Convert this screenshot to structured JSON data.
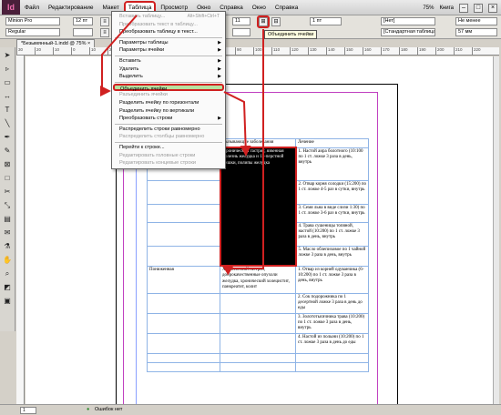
{
  "menubar": {
    "logo": "Id",
    "items": [
      "Файл",
      "Редактирование",
      "Макет",
      "Таблица",
      "Просмотр",
      "Окно",
      "Справка",
      "Окно",
      "Справка"
    ],
    "zoom": "75%",
    "workspace": "Книга"
  },
  "controlbar": {
    "font": "Minion Pro",
    "style": "Regular",
    "size1": "12 пт",
    "size2": "11",
    "stroke": "1 пт",
    "cell_style": "[Нет]",
    "table_style": "[Стандартная таблица]",
    "min_label": "Не менее",
    "height": "57 мм",
    "tooltip": "Объединить ячейки"
  },
  "doc_tab": "*Безымянный-1.indd @ 75% ×",
  "ruler_marks": [
    "30",
    "20",
    "10",
    "0",
    "10",
    "20",
    "30",
    "40",
    "50",
    "60",
    "70",
    "80",
    "90",
    "100",
    "110",
    "120",
    "130",
    "140",
    "150",
    "160",
    "170",
    "180",
    "190",
    "200",
    "210",
    "220"
  ],
  "table_menu": {
    "items": [
      {
        "label": "Вставить таблицу...",
        "shortcut": "Alt+Shift+Ctrl+T",
        "disabled": true
      },
      {
        "label": "Преобразовать текст в таблицу...",
        "disabled": true
      },
      {
        "label": "Преобразовать таблицу в текст...",
        "disabled": false
      },
      {
        "sep": true
      },
      {
        "label": "Параметры таблицы",
        "arrow": true
      },
      {
        "label": "Параметры ячейки",
        "arrow": true
      },
      {
        "sep": true
      },
      {
        "label": "Вставить",
        "arrow": true
      },
      {
        "label": "Удалить",
        "arrow": true
      },
      {
        "label": "Выделить",
        "arrow": true
      },
      {
        "sep": true
      },
      {
        "label": "Объединить ячейки",
        "highlight": true
      },
      {
        "label": "Разъединить ячейки",
        "disabled": true
      },
      {
        "label": "Разделить ячейку по горизонтали"
      },
      {
        "label": "Разделить ячейку по вертикали"
      },
      {
        "label": "Преобразовать строки",
        "arrow": true
      },
      {
        "sep": true
      },
      {
        "label": "Распределить строки равномерно"
      },
      {
        "label": "Распределить столбцы равномерно",
        "disabled": true
      },
      {
        "sep": true
      },
      {
        "label": "Перейти к строке..."
      },
      {
        "label": "Редактировать головные строки",
        "disabled": true
      },
      {
        "label": "Редактировать концевые строки",
        "disabled": true
      }
    ]
  },
  "table": {
    "header": [
      "",
      "Вызывающие заболевания",
      "Лечение"
    ],
    "row1_disease": "Хронический гастрит, язвенная болезнь желудка и 12-перстной кишки, полипы желудка",
    "row1_treatments": [
      "1. Настой аира болотного (10:100 по 1 ст. ложке 3 раза в день, внутрь",
      "2. Отвар корня солодки (15:200) по 1 ст. ложке 4-5 раз в сутки, внутрь",
      "3. Семя льна в виде слизи 1:30) по 1 ст. ложке 3-6 раз в сутки, внутрь",
      "4. Трава сушеницы топяной, настой (10:200) по 1 ст. ложке 3 раза в день, внутрь",
      "5. Масло облепиховое по 1 чайной ложке 3 раза в день, внутрь"
    ],
    "row2_label": "Пониженная",
    "row2_disease": "Хронический гастрит, доброкачественные опухоли желудка, хронический холецистит, панкреатит, колит",
    "row2_treatments": [
      "1. Отвар из корней одуванчика (6-10:200) по 1 ст. ложке 3 раза в день, внутрь",
      "2. Сок подорожника по 1 десертной ложке 3 раза в день до еды",
      "3. Золототысячника трава (10:200) по 1 ст. ложке 3 раза в день, внутрь",
      "4. Настой из полыни (10:200) по 1 ст. ложке 3 раза в день до еды"
    ]
  },
  "statusbar": {
    "page": "1",
    "errors": "Ошибок нет"
  },
  "colors": {
    "annotation": "#d02020",
    "highlight": "#b6e0a0",
    "table_border": "#8fb4e6",
    "margin_guide": "#c040c0"
  }
}
